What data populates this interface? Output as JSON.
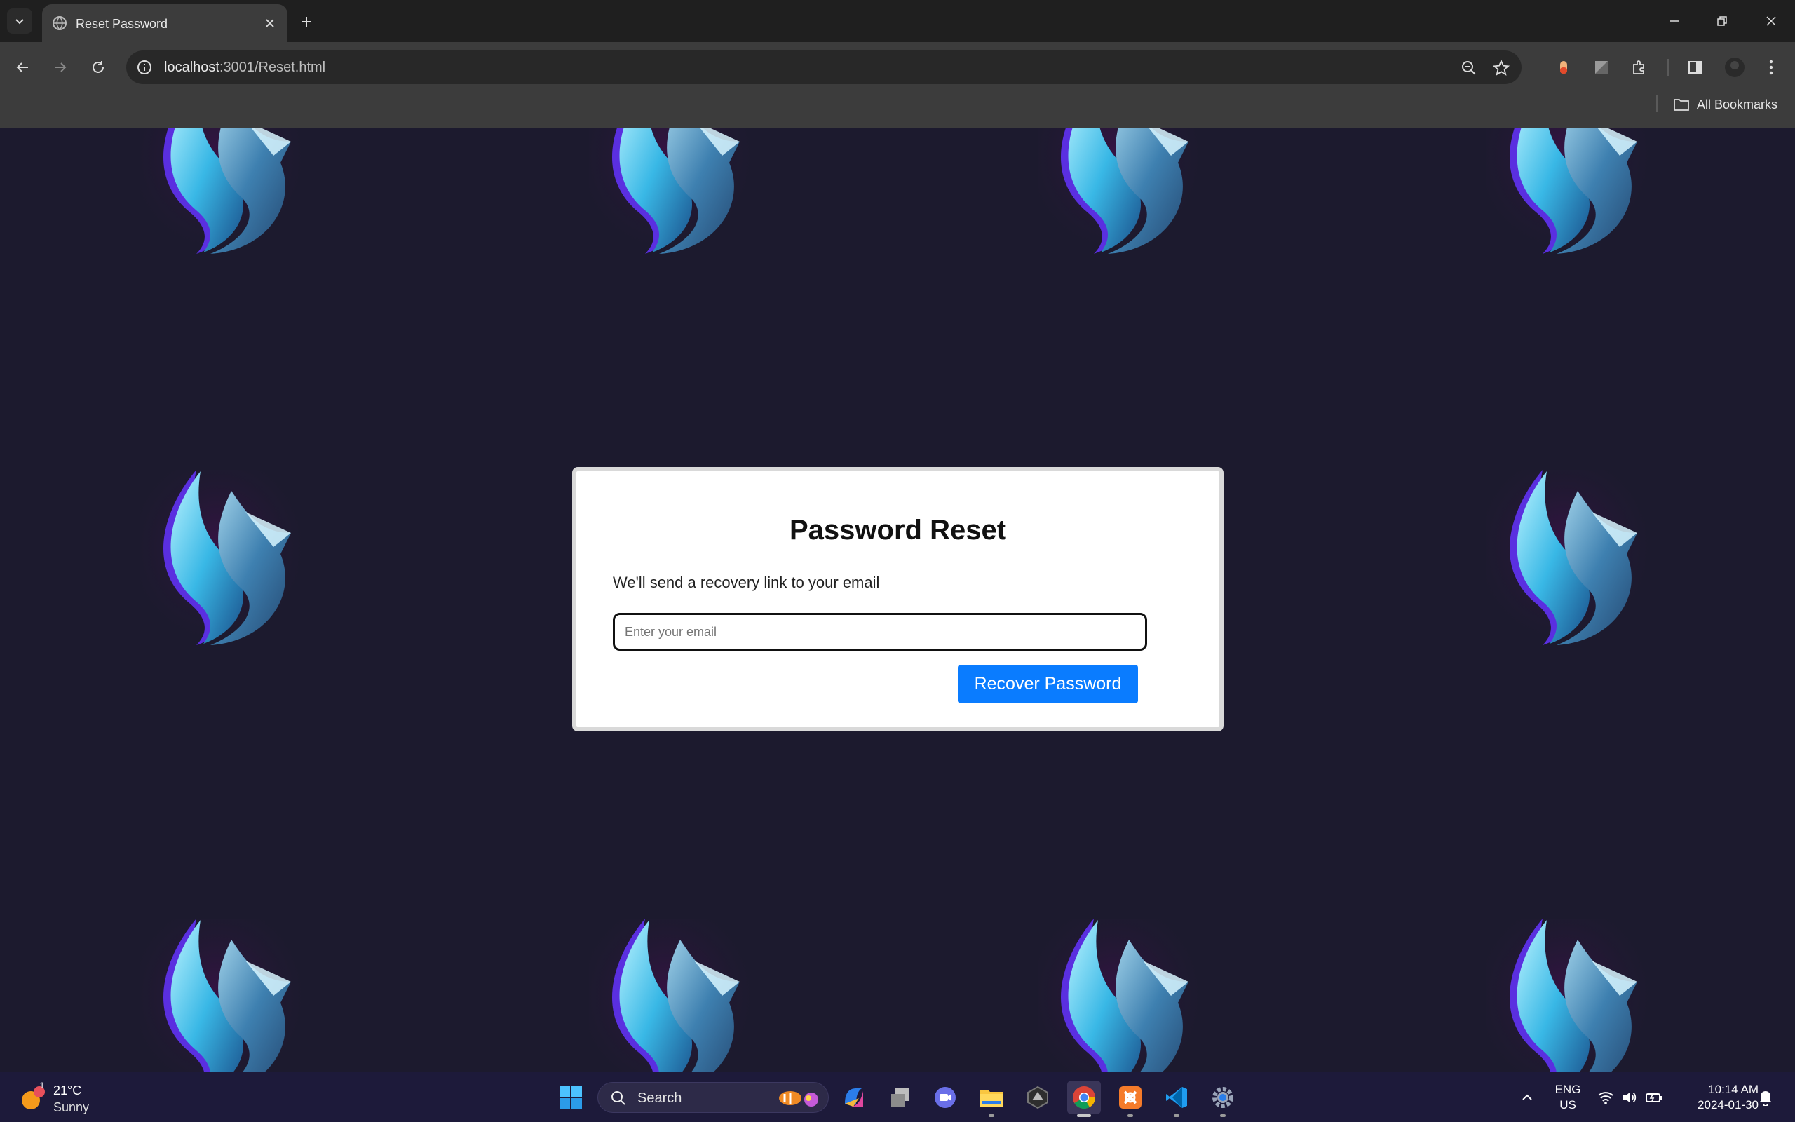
{
  "browser": {
    "tab_title": "Reset Password",
    "url_host": "localhost",
    "url_path": ":3001/Reset.html",
    "all_bookmarks_label": "All Bookmarks"
  },
  "card": {
    "heading": "Password Reset",
    "subtitle": "We'll send a recovery link to your email",
    "email_placeholder": "Enter your email",
    "email_value": "",
    "button_label": "Recover Password"
  },
  "taskbar": {
    "weather_temp": "21°C",
    "weather_condition": "Sunny",
    "weather_badge": "1",
    "search_label": "Search",
    "language": "ENG",
    "region": "US",
    "time": "10:14 AM",
    "date": "2024-01-30"
  },
  "colors": {
    "page_bg": "#1c1a2e",
    "button_bg": "#0a7cff",
    "taskbar_bg": "#1d1a3a"
  }
}
